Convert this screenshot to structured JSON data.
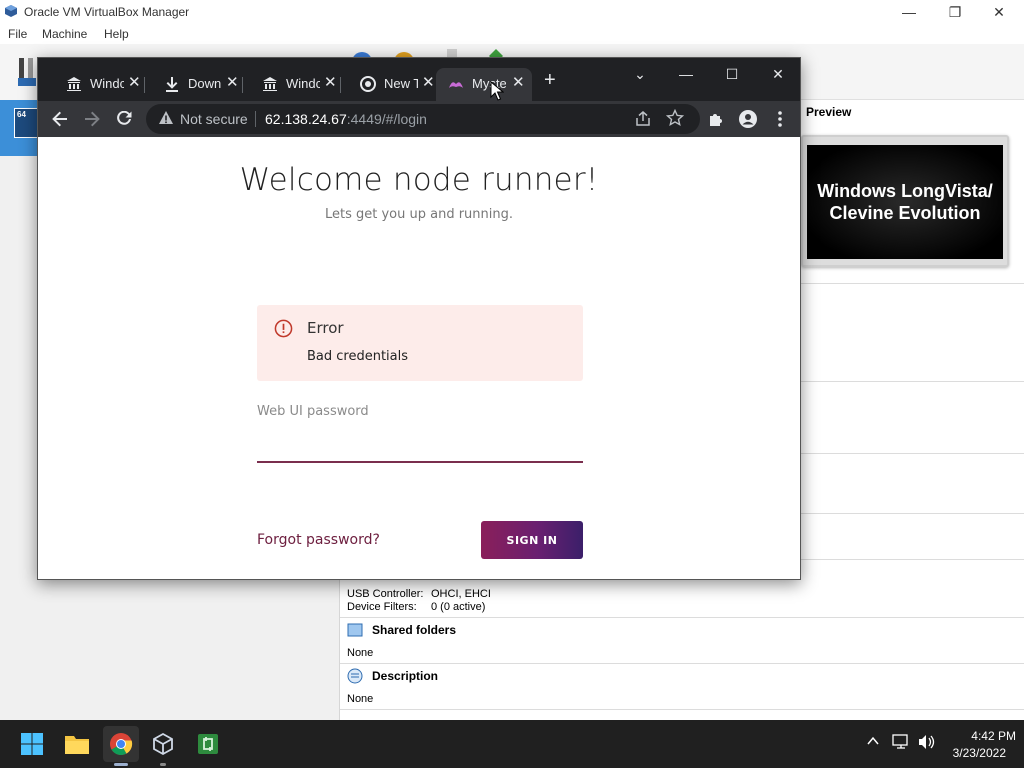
{
  "vbox": {
    "title": "Oracle VM VirtualBox Manager",
    "menu": [
      "File",
      "Machine",
      "Help"
    ],
    "preview": {
      "title": "Preview",
      "screen_text_line1": "Windows LongVista/",
      "screen_text_line2": "Clevine Evolution"
    },
    "usb": {
      "controller_label": "USB Controller:",
      "controller_value": "OHCI, EHCI",
      "filters_label": "Device Filters:",
      "filters_value": "0 (0 active)"
    },
    "shared_folders": {
      "title": "Shared folders",
      "value": "None"
    },
    "description": {
      "title": "Description",
      "value": "None"
    },
    "vm_badge": "64"
  },
  "chrome": {
    "tabs": [
      {
        "label": "Windc",
        "icon": "bank-icon"
      },
      {
        "label": "Downl",
        "icon": "download-icon"
      },
      {
        "label": "Windc",
        "icon": "bank-icon"
      },
      {
        "label": "New T",
        "icon": "chrome-icon"
      },
      {
        "label": "Myste",
        "icon": "mysterium-icon",
        "active": true
      }
    ],
    "omnibox": {
      "security": "Not secure",
      "host": "62.138.24.67",
      "rest": ":4449/#/login"
    }
  },
  "page": {
    "heading": "Welcome node runner!",
    "subtitle": "Lets get you up and running.",
    "error": {
      "title": "Error",
      "message": "Bad credentials"
    },
    "password_label": "Web UI password",
    "password_value": "",
    "forgot_label": "Forgot password?",
    "signin_label": "SIGN IN"
  },
  "taskbar": {
    "time": "4:42 PM",
    "date": "3/23/2022"
  },
  "colors": {
    "signin_gradient_start": "#8a1f5a",
    "signin_gradient_end": "#3b1f6a",
    "error_bg": "#fdecea",
    "error_icon": "#c0392b",
    "input_underline": "#7a2e4e",
    "forgot_link": "#6e2040",
    "vm_selected": "#3c8fd8"
  }
}
